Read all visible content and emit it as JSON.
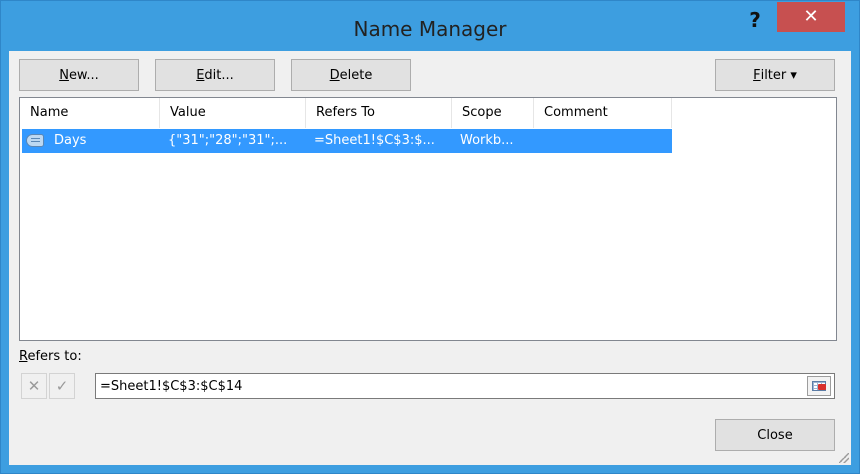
{
  "window": {
    "title": "Name Manager",
    "help_label": "?",
    "close_label": "✕"
  },
  "toolbar": {
    "new_ul": "N",
    "new_rest": "ew...",
    "edit_ul": "E",
    "edit_rest": "dit...",
    "delete_ul": "D",
    "delete_rest": "elete",
    "filter_ul": "F",
    "filter_rest": "ilter ▾"
  },
  "list": {
    "columns": [
      "Name",
      "Value",
      "Refers To",
      "Scope",
      "Comment"
    ],
    "rows": [
      {
        "name": "Days",
        "value": "{\"31\";\"28\";\"31\";...",
        "refers_to": "=Sheet1!$C$3:$...",
        "scope": "Workb...",
        "comment": "",
        "selected": true
      }
    ]
  },
  "refers_to": {
    "label_ul": "R",
    "label_rest": "efers to:",
    "value": "=Sheet1!$C$3:$C$14",
    "cancel_glyph": "✕",
    "confirm_glyph": "✓"
  },
  "footer": {
    "close_label": "Close"
  },
  "colors": {
    "titlebar": "#3d9ee0",
    "close_button": "#c75050",
    "selection": "#3399ff"
  }
}
